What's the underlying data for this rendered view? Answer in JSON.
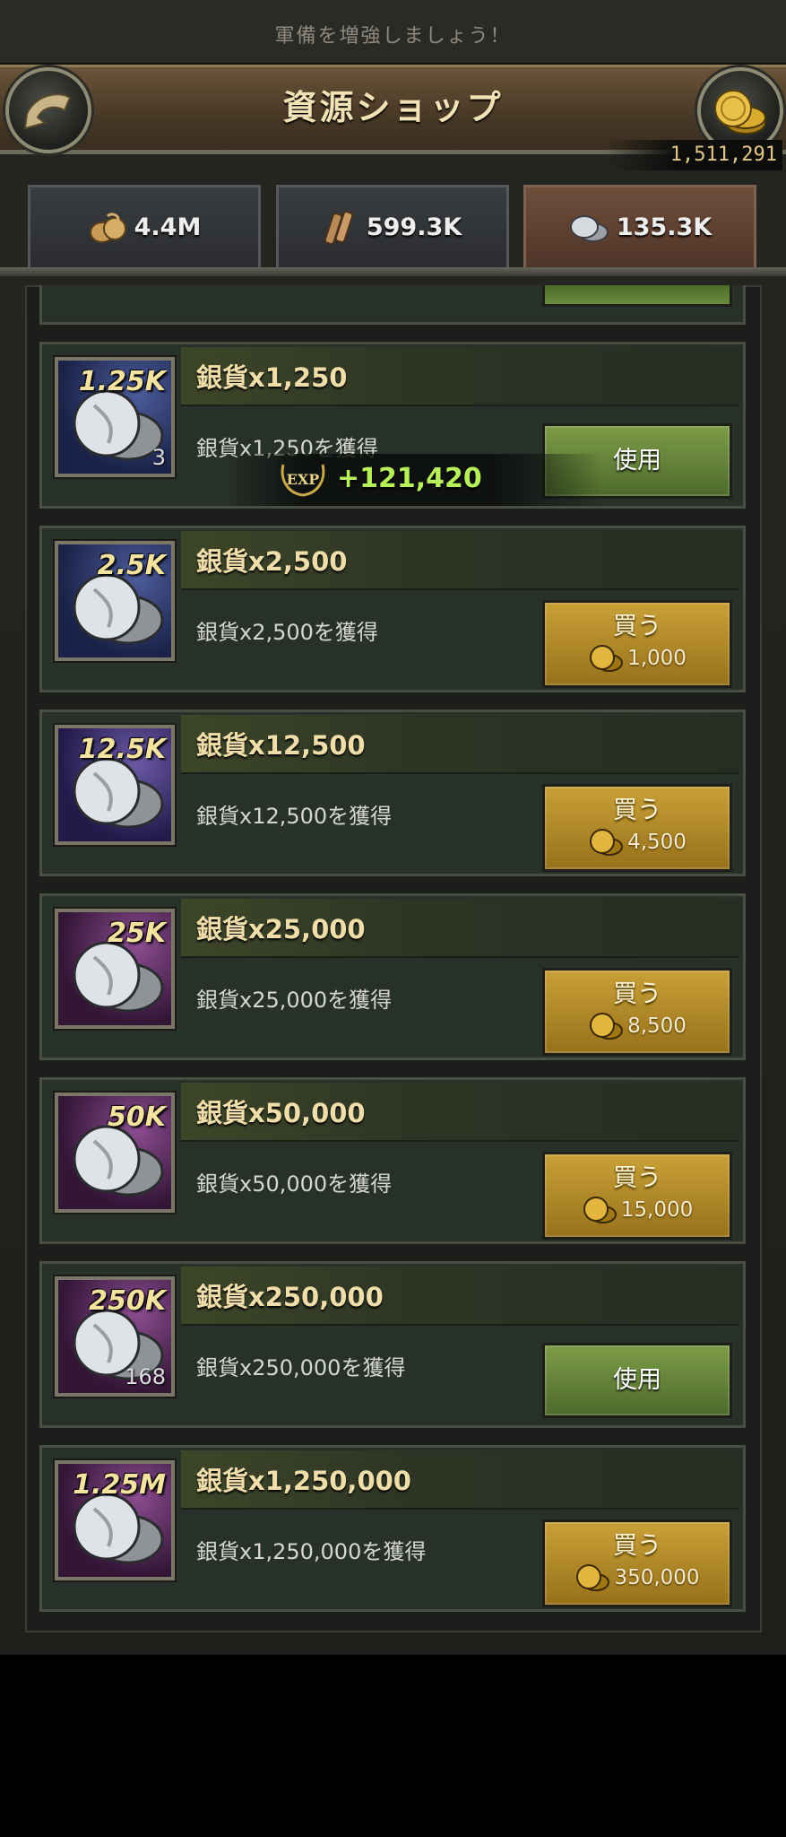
{
  "banner": {
    "text": "軍備を増強しましょう！"
  },
  "header": {
    "title": "資源ショップ",
    "gold_amount": "1,511,291"
  },
  "resource_tabs": [
    {
      "icon": "food-icon",
      "value": "4.4M"
    },
    {
      "icon": "wood-icon",
      "value": "599.3K"
    },
    {
      "icon": "silver-icon",
      "value": "135.3K",
      "active": true
    }
  ],
  "exp_gain": {
    "icon": "exp-icon",
    "value": "+121,420"
  },
  "items": [
    {
      "amount": "1.25K",
      "count": "3",
      "title": "銀貨x1,250",
      "desc": "銀貨x1,250を獲得",
      "action": "使用"
    },
    {
      "amount": "2.5K",
      "title": "銀貨x2,500",
      "desc": "銀貨x2,500を獲得",
      "action": "買う",
      "price": "1,000"
    },
    {
      "amount": "12.5K",
      "title": "銀貨x12,500",
      "desc": "銀貨x12,500を獲得",
      "action": "買う",
      "price": "4,500"
    },
    {
      "amount": "25K",
      "title": "銀貨x25,000",
      "desc": "銀貨x25,000を獲得",
      "action": "買う",
      "price": "8,500"
    },
    {
      "amount": "50K",
      "title": "銀貨x50,000",
      "desc": "銀貨x50,000を獲得",
      "action": "買う",
      "price": "15,000"
    },
    {
      "amount": "250K",
      "count": "168",
      "title": "銀貨x250,000",
      "desc": "銀貨x250,000を獲得",
      "action": "使用"
    },
    {
      "amount": "1.25M",
      "title": "銀貨x1,250,000",
      "desc": "銀貨x1,250,000を獲得",
      "action": "買う",
      "price": "350,000"
    }
  ],
  "colors": {
    "use_button": "#6a8a3c",
    "buy_button": "#b58c2a",
    "title_text": "#f0deaa",
    "exp_text": "#b7f05a"
  }
}
